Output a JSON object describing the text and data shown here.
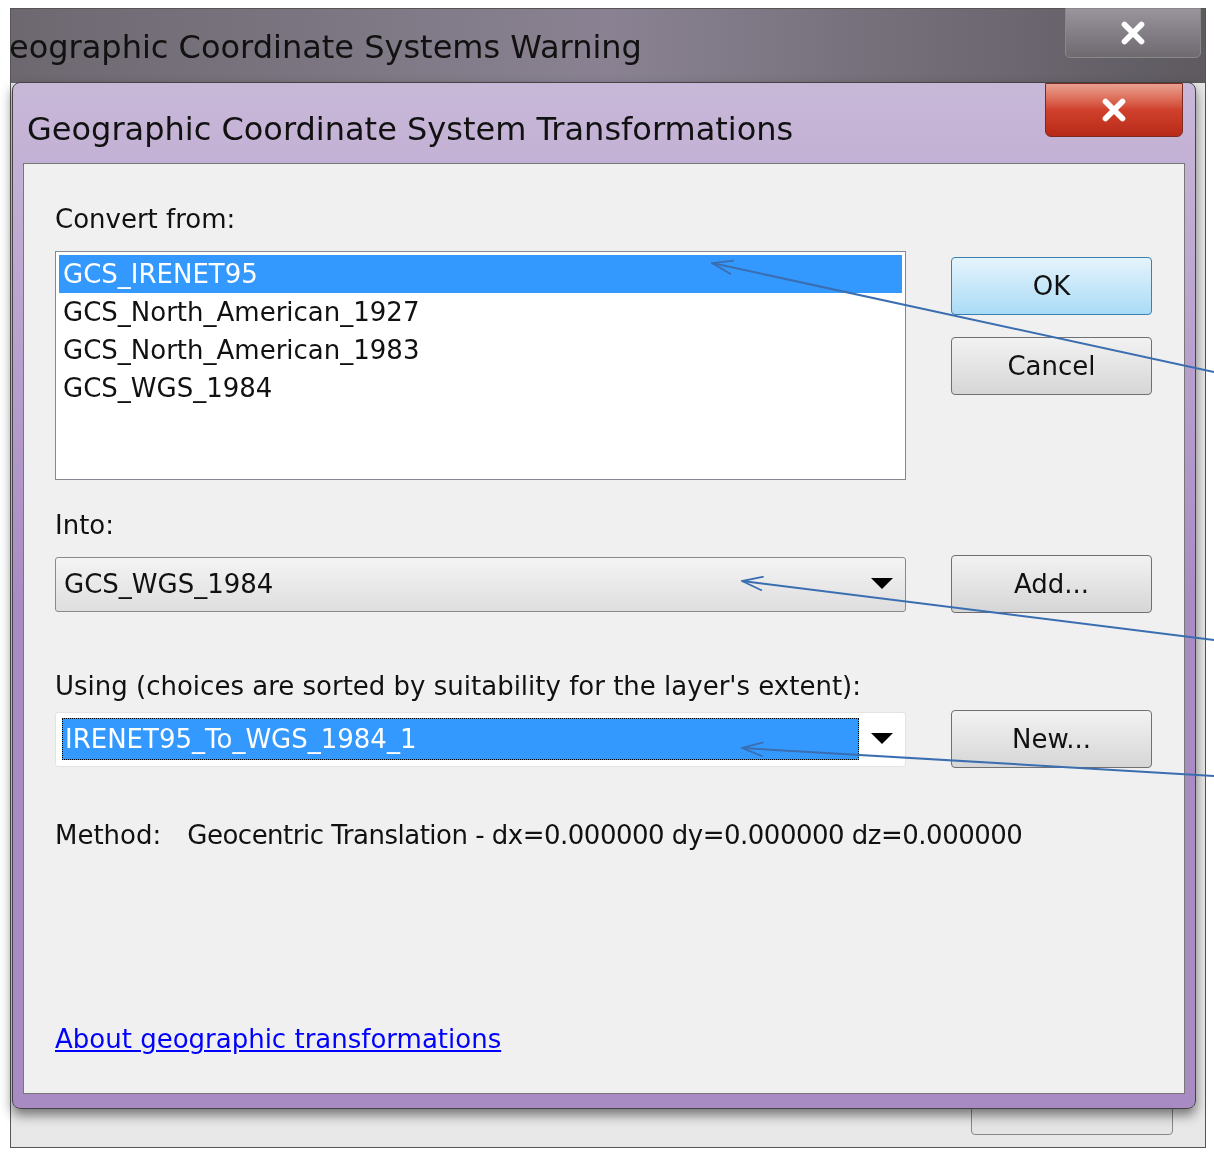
{
  "background_window": {
    "title": "eographic Coordinate Systems Warning"
  },
  "dialog": {
    "title": "Geographic Coordinate System Transformations",
    "convert_from": {
      "label": "Convert from:",
      "items": [
        {
          "label": "GCS_IRENET95",
          "selected": true
        },
        {
          "label": "GCS_North_American_1927",
          "selected": false
        },
        {
          "label": "GCS_North_American_1983",
          "selected": false
        },
        {
          "label": "GCS_WGS_1984",
          "selected": false
        }
      ]
    },
    "into": {
      "label": "Into:",
      "value": "GCS_WGS_1984",
      "selected": false
    },
    "using": {
      "label": "Using (choices are sorted by suitability for the layer's extent):",
      "value": "IRENET95_To_WGS_1984_1",
      "selected": true
    },
    "method": {
      "label": "Method:",
      "value": "Geocentric Translation - dx=0.000000 dy=0.000000 dz=0.000000"
    },
    "link": "About geographic transformations",
    "buttons": [
      {
        "label": "OK",
        "default": true
      },
      {
        "label": "Cancel",
        "default": false
      },
      {
        "label": "Add...",
        "default": false
      },
      {
        "label": "New...",
        "default": false
      }
    ]
  }
}
